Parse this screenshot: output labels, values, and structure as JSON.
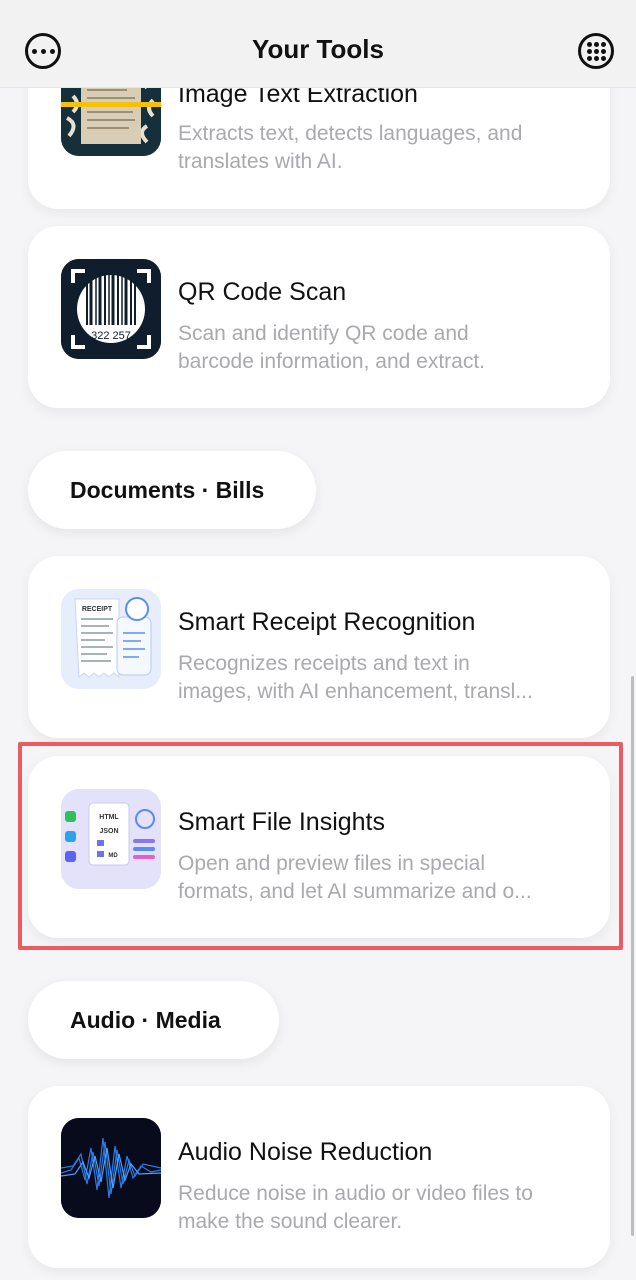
{
  "header": {
    "title": "Your Tools",
    "left_icon": "more-dots-icon",
    "right_icon": "grid-menu-icon"
  },
  "tools": [
    {
      "title": "Image Text Extraction",
      "desc_line1": "Extracts text, detects languages, and",
      "desc_line2": "translates with AI.",
      "icon": "document-scan-icon"
    },
    {
      "title": "QR Code Scan",
      "desc_line1": "Scan and identify QR code and",
      "desc_line2": "barcode information, and extract.",
      "icon": "barcode-icon",
      "barcode_number": "322 257"
    },
    {
      "title": "Smart Receipt Recognition",
      "desc_line1": "Recognizes receipts and text in",
      "desc_line2": "images, with AI enhancement, transl...",
      "icon": "receipt-icon",
      "receipt_label": "RECEIPT"
    },
    {
      "title": "Smart File Insights",
      "desc_line1": "Open and preview files in special",
      "desc_line2": "formats, and let AI summarize and o...",
      "icon": "file-insight-icon",
      "format_labels": [
        "HTML",
        "JSON",
        "MD"
      ]
    },
    {
      "title": "Audio Noise Reduction",
      "desc_line1": "Reduce noise in audio or video files to",
      "desc_line2": "make the sound clearer.",
      "icon": "sound-wave-icon"
    }
  ],
  "sections": {
    "documents": "Documents · Bills",
    "audio": "Audio · Media"
  },
  "colors": {
    "highlight": "#e85d62",
    "background": "#f5f5f7",
    "description": "#a9a9ae"
  }
}
